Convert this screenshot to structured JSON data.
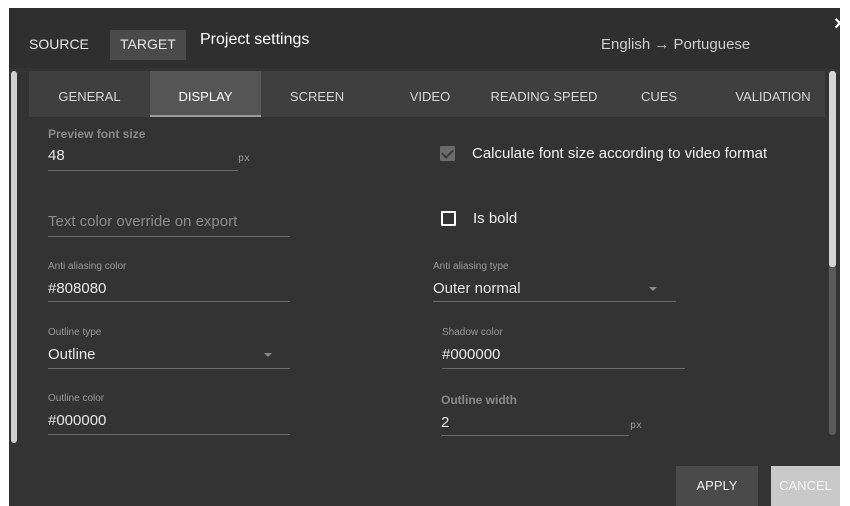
{
  "header": {
    "tabs": [
      {
        "label": "SOURCE"
      },
      {
        "label": "TARGET"
      }
    ],
    "title": "Project settings",
    "language": "English → Portuguese",
    "close": "×"
  },
  "tabs": [
    {
      "label": "GENERAL"
    },
    {
      "label": "DISPLAY"
    },
    {
      "label": "SCREEN"
    },
    {
      "label": "VIDEO"
    },
    {
      "label": "READING SPEED"
    },
    {
      "label": "CUES"
    },
    {
      "label": "VALIDATION"
    }
  ],
  "active_tab": "DISPLAY",
  "form": {
    "preview_font_size": {
      "label": "Preview font size",
      "value": "48",
      "unit": "px"
    },
    "calc_font_size": {
      "label": "Calculate font size according to video format",
      "checked": true
    },
    "text_color_override": {
      "placeholder": "Text color override on export"
    },
    "is_bold": {
      "label": "Is bold",
      "checked": false
    },
    "anti_aliasing_color": {
      "label": "Anti aliasing color",
      "value": "#808080"
    },
    "anti_aliasing_type": {
      "label": "Anti aliasing type",
      "value": "Outer normal"
    },
    "outline_type": {
      "label": "Outline type",
      "value": "Outline"
    },
    "shadow_color": {
      "label": "Shadow color",
      "value": "#000000"
    },
    "outline_color": {
      "label": "Outline color",
      "value": "#000000"
    },
    "outline_width": {
      "label": "Outline width",
      "value": "2",
      "unit": "px"
    }
  },
  "buttons": {
    "apply": "APPLY",
    "cancel": "CANCEL"
  }
}
